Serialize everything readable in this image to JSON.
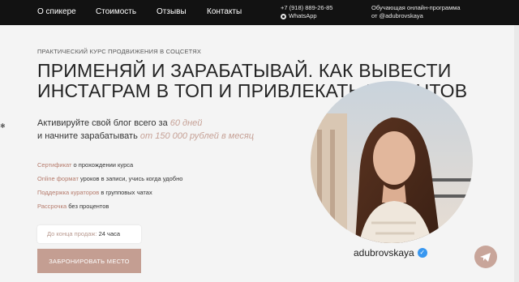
{
  "nav": {
    "items": [
      {
        "label": "О спикере"
      },
      {
        "label": "Стоимость"
      },
      {
        "label": "Отзывы"
      },
      {
        "label": "Контакты"
      }
    ],
    "phone": "+7 (918) 889-26-85",
    "whatsapp_label": "WhatsApp",
    "promo_line1": "Обучающая онлайн-программа",
    "promo_line2": "от @adubrovskaya"
  },
  "hero": {
    "kicker": "ПРАКТИЧЕСКИЙ КУРС ПРОДВИЖЕНИЯ В СОЦСЕТЯХ",
    "title_line1": "ПРИМЕНЯЙ И ЗАРАБАТЫВАЙ. КАК ВЫВЕСТИ",
    "title_line2": "ИНСТАГРАМ В ТОП И ПРИВЛЕКАТЬ КЛИЕНТОВ",
    "lead1_text": "Активируйте свой блог всего за ",
    "lead1_accent": "60 дней",
    "lead2_text": "и начните зарабатывать ",
    "lead2_accent": "от 150 000 рублей в месяц",
    "features": [
      {
        "key": "Сертификат",
        "text": " о прохождении курса"
      },
      {
        "key": "Online формат",
        "text": " уроков в записи, учись когда удобно"
      },
      {
        "key": "Поддержка кураторов",
        "text": " в групповых чатах"
      },
      {
        "key": "Рассрочка",
        "text": " без процентов"
      }
    ],
    "timer_label": "До конца продаж:",
    "timer_value": " 24 часа",
    "cta_label": "ЗАБРОНИРОВАТЬ МЕСТО"
  },
  "speaker": {
    "username": "adubrovskaya",
    "verified_icon": "verified-check-icon"
  },
  "icons": {
    "whatsapp": "whatsapp-icon",
    "telegram": "telegram-icon"
  },
  "colors": {
    "topbar": "#121212",
    "accent": "#c6a196",
    "cta": "#c49e92"
  }
}
